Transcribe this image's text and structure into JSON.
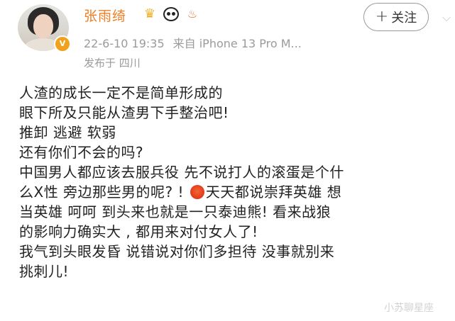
{
  "post": {
    "username": "张雨绮",
    "timestamp": "22-6-10 19:35",
    "source": "来自 iPhone 13 Pro M...",
    "location": "发布于 四川",
    "follow_label": "关注",
    "follow_plus": "+",
    "verified_badge": "V",
    "badges": [
      "vip-crown-icon",
      "panda-icon",
      "torch-icon"
    ],
    "content_lines": [
      "人渣的成长一定不是简单形成的",
      "眼下所及只能从渣男下手整治吧!",
      "推卸 逃避 软弱",
      "还有你们不会的吗?",
      "中国男人都应该去服兵役 先不说打人的滚蛋是个什",
      "么X性 旁边那些男的呢? !",
      "天天都说崇拜英雄 想",
      "当英雄 呵呵 到头来也就是一只泰迪熊! 看来战狼",
      "的影响力确实大 , 都用来对付女人了!",
      "我气到头眼发昏 说错说对你们多担待 没事就别来",
      "挑刺儿!"
    ]
  },
  "watermark": "小苏聊星座",
  "colors": {
    "username": "#ef7d23",
    "meta": "#9b9b9b",
    "text": "#222222",
    "verified": "#f0a21c"
  }
}
